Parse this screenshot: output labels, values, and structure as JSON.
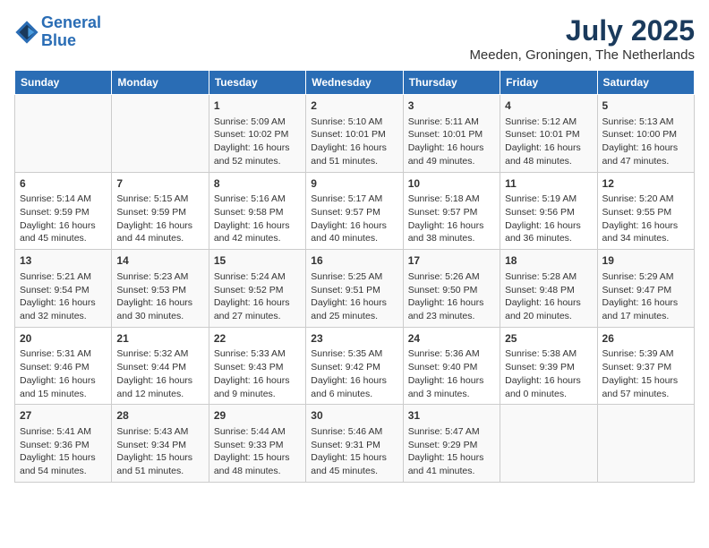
{
  "header": {
    "logo_line1": "General",
    "logo_line2": "Blue",
    "month": "July 2025",
    "location": "Meeden, Groningen, The Netherlands"
  },
  "weekdays": [
    "Sunday",
    "Monday",
    "Tuesday",
    "Wednesday",
    "Thursday",
    "Friday",
    "Saturday"
  ],
  "weeks": [
    [
      {
        "day": "",
        "content": ""
      },
      {
        "day": "",
        "content": ""
      },
      {
        "day": "1",
        "content": "Sunrise: 5:09 AM\nSunset: 10:02 PM\nDaylight: 16 hours and 52 minutes."
      },
      {
        "day": "2",
        "content": "Sunrise: 5:10 AM\nSunset: 10:01 PM\nDaylight: 16 hours and 51 minutes."
      },
      {
        "day": "3",
        "content": "Sunrise: 5:11 AM\nSunset: 10:01 PM\nDaylight: 16 hours and 49 minutes."
      },
      {
        "day": "4",
        "content": "Sunrise: 5:12 AM\nSunset: 10:01 PM\nDaylight: 16 hours and 48 minutes."
      },
      {
        "day": "5",
        "content": "Sunrise: 5:13 AM\nSunset: 10:00 PM\nDaylight: 16 hours and 47 minutes."
      }
    ],
    [
      {
        "day": "6",
        "content": "Sunrise: 5:14 AM\nSunset: 9:59 PM\nDaylight: 16 hours and 45 minutes."
      },
      {
        "day": "7",
        "content": "Sunrise: 5:15 AM\nSunset: 9:59 PM\nDaylight: 16 hours and 44 minutes."
      },
      {
        "day": "8",
        "content": "Sunrise: 5:16 AM\nSunset: 9:58 PM\nDaylight: 16 hours and 42 minutes."
      },
      {
        "day": "9",
        "content": "Sunrise: 5:17 AM\nSunset: 9:57 PM\nDaylight: 16 hours and 40 minutes."
      },
      {
        "day": "10",
        "content": "Sunrise: 5:18 AM\nSunset: 9:57 PM\nDaylight: 16 hours and 38 minutes."
      },
      {
        "day": "11",
        "content": "Sunrise: 5:19 AM\nSunset: 9:56 PM\nDaylight: 16 hours and 36 minutes."
      },
      {
        "day": "12",
        "content": "Sunrise: 5:20 AM\nSunset: 9:55 PM\nDaylight: 16 hours and 34 minutes."
      }
    ],
    [
      {
        "day": "13",
        "content": "Sunrise: 5:21 AM\nSunset: 9:54 PM\nDaylight: 16 hours and 32 minutes."
      },
      {
        "day": "14",
        "content": "Sunrise: 5:23 AM\nSunset: 9:53 PM\nDaylight: 16 hours and 30 minutes."
      },
      {
        "day": "15",
        "content": "Sunrise: 5:24 AM\nSunset: 9:52 PM\nDaylight: 16 hours and 27 minutes."
      },
      {
        "day": "16",
        "content": "Sunrise: 5:25 AM\nSunset: 9:51 PM\nDaylight: 16 hours and 25 minutes."
      },
      {
        "day": "17",
        "content": "Sunrise: 5:26 AM\nSunset: 9:50 PM\nDaylight: 16 hours and 23 minutes."
      },
      {
        "day": "18",
        "content": "Sunrise: 5:28 AM\nSunset: 9:48 PM\nDaylight: 16 hours and 20 minutes."
      },
      {
        "day": "19",
        "content": "Sunrise: 5:29 AM\nSunset: 9:47 PM\nDaylight: 16 hours and 17 minutes."
      }
    ],
    [
      {
        "day": "20",
        "content": "Sunrise: 5:31 AM\nSunset: 9:46 PM\nDaylight: 16 hours and 15 minutes."
      },
      {
        "day": "21",
        "content": "Sunrise: 5:32 AM\nSunset: 9:44 PM\nDaylight: 16 hours and 12 minutes."
      },
      {
        "day": "22",
        "content": "Sunrise: 5:33 AM\nSunset: 9:43 PM\nDaylight: 16 hours and 9 minutes."
      },
      {
        "day": "23",
        "content": "Sunrise: 5:35 AM\nSunset: 9:42 PM\nDaylight: 16 hours and 6 minutes."
      },
      {
        "day": "24",
        "content": "Sunrise: 5:36 AM\nSunset: 9:40 PM\nDaylight: 16 hours and 3 minutes."
      },
      {
        "day": "25",
        "content": "Sunrise: 5:38 AM\nSunset: 9:39 PM\nDaylight: 16 hours and 0 minutes."
      },
      {
        "day": "26",
        "content": "Sunrise: 5:39 AM\nSunset: 9:37 PM\nDaylight: 15 hours and 57 minutes."
      }
    ],
    [
      {
        "day": "27",
        "content": "Sunrise: 5:41 AM\nSunset: 9:36 PM\nDaylight: 15 hours and 54 minutes."
      },
      {
        "day": "28",
        "content": "Sunrise: 5:43 AM\nSunset: 9:34 PM\nDaylight: 15 hours and 51 minutes."
      },
      {
        "day": "29",
        "content": "Sunrise: 5:44 AM\nSunset: 9:33 PM\nDaylight: 15 hours and 48 minutes."
      },
      {
        "day": "30",
        "content": "Sunrise: 5:46 AM\nSunset: 9:31 PM\nDaylight: 15 hours and 45 minutes."
      },
      {
        "day": "31",
        "content": "Sunrise: 5:47 AM\nSunset: 9:29 PM\nDaylight: 15 hours and 41 minutes."
      },
      {
        "day": "",
        "content": ""
      },
      {
        "day": "",
        "content": ""
      }
    ]
  ]
}
